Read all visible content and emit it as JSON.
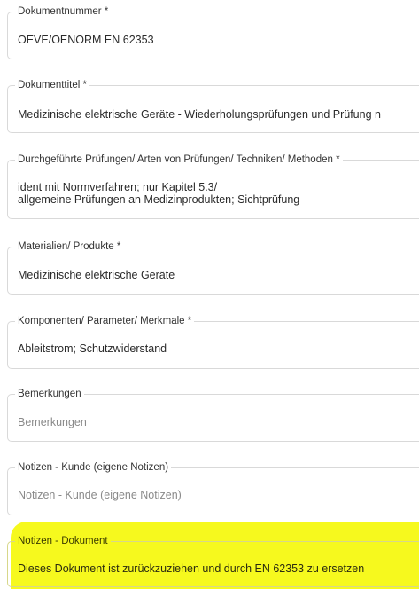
{
  "fields": [
    {
      "label": "Dokumentnummer *",
      "value": "OEVE/OENORM EN 62353",
      "is_placeholder": false
    },
    {
      "label": "Dokumenttitel *",
      "value": "Medizinische elektrische Geräte - Wiederholungsprüfungen und Prüfung n",
      "is_placeholder": false
    },
    {
      "label": "Durchgeführte Prüfungen/ Arten von Prüfungen/ Techniken/ Methoden *",
      "value_lines": [
        "ident mit Normverfahren; nur Kapitel 5.3/",
        "allgemeine Prüfungen an Medizinprodukten; Sichtprüfung"
      ],
      "is_placeholder": false
    },
    {
      "label": "Materialien/ Produkte *",
      "value": "Medizinische elektrische Geräte",
      "is_placeholder": false
    },
    {
      "label": "Komponenten/ Parameter/ Merkmale *",
      "value": "Ableitstrom; Schutzwiderstand",
      "is_placeholder": false
    },
    {
      "label": "Bemerkungen",
      "placeholder": "Bemerkungen",
      "value": "",
      "is_placeholder": true
    },
    {
      "label": "Notizen - Kunde (eigene Notizen)",
      "placeholder": "Notizen - Kunde (eigene Notizen)",
      "value": "",
      "is_placeholder": true
    },
    {
      "label": "Notizen - Dokument",
      "value": "Dieses Dokument ist zurückzuziehen und durch EN 62353 zu ersetzen",
      "is_placeholder": false,
      "highlighted": true
    }
  ],
  "colors": {
    "highlight": "#f6f91e",
    "border": "#d9d9d9",
    "placeholder_text": "#8a8a8a"
  }
}
